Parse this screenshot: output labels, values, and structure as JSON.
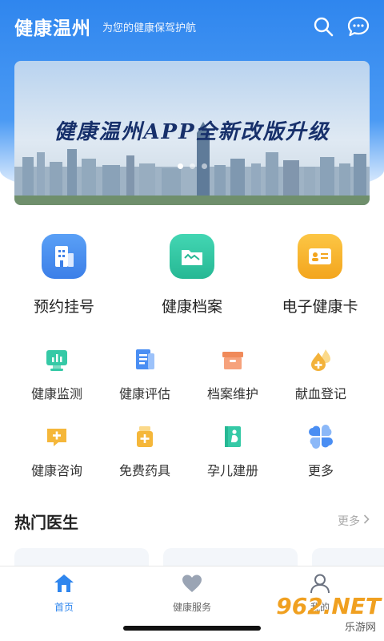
{
  "header": {
    "title": "健康温州",
    "slogan": "为您的健康保驾护航",
    "icons": [
      "search-icon",
      "message-icon"
    ]
  },
  "banner": {
    "title": "健康温州APP全新改版升级",
    "page_count": 3,
    "active_page": 1
  },
  "main_services": [
    {
      "label": "预约挂号",
      "icon": "building-icon",
      "color": "#4a8ef3"
    },
    {
      "label": "健康档案",
      "icon": "folder-icon",
      "color": "#35c9a6"
    },
    {
      "label": "电子健康卡",
      "icon": "id-card-icon",
      "color": "#f7b630"
    }
  ],
  "grid_services": [
    {
      "label": "健康监测",
      "icon": "monitor-icon"
    },
    {
      "label": "健康评估",
      "icon": "report-icon"
    },
    {
      "label": "档案维护",
      "icon": "archive-box-icon"
    },
    {
      "label": "献血登记",
      "icon": "blood-drop-icon"
    },
    {
      "label": "健康咨询",
      "icon": "chat-plus-icon"
    },
    {
      "label": "免费药具",
      "icon": "medicine-bottle-icon"
    },
    {
      "label": "孕儿建册",
      "icon": "pregnancy-book-icon"
    },
    {
      "label": "更多",
      "icon": "more-grid-icon"
    }
  ],
  "hot_doctors": {
    "title": "热门医生",
    "more_label": "更多"
  },
  "tabbar": [
    {
      "label": "首页",
      "icon": "home-icon",
      "active": true
    },
    {
      "label": "健康服务",
      "icon": "heart-icon",
      "active": false
    },
    {
      "label": "我的",
      "icon": "user-icon",
      "active": false
    }
  ],
  "watermark": {
    "main": "962.NET",
    "sub": "乐游网"
  },
  "colors": {
    "accent": "#2f86ee",
    "green": "#35c9a6",
    "yellow": "#f7b630",
    "icon_orange": "#f0a020"
  }
}
